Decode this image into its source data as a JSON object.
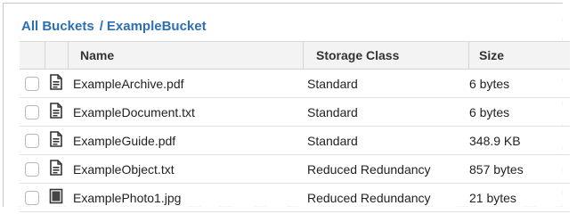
{
  "breadcrumb": {
    "root": "All Buckets",
    "separator": "/",
    "current": "ExampleBucket"
  },
  "table": {
    "columns": {
      "name": "Name",
      "storage_class": "Storage Class",
      "size": "Size"
    },
    "rows": [
      {
        "icon": "document-icon",
        "name": "ExampleArchive.pdf",
        "storage_class": "Standard",
        "size": "6 bytes"
      },
      {
        "icon": "document-icon",
        "name": "ExampleDocument.txt",
        "storage_class": "Standard",
        "size": "6 bytes"
      },
      {
        "icon": "document-icon",
        "name": "ExampleGuide.pdf",
        "storage_class": "Standard",
        "size": "348.9 KB"
      },
      {
        "icon": "document-icon",
        "name": "ExampleObject.txt",
        "storage_class": "Reduced Redundancy",
        "size": "857 bytes"
      },
      {
        "icon": "image-icon",
        "name": "ExamplePhoto1.jpg",
        "storage_class": "Reduced Redundancy",
        "size": "21 bytes"
      }
    ]
  },
  "colors": {
    "link": "#2c6fb4",
    "header_bg": "#f3f3f3",
    "text": "#222222"
  }
}
